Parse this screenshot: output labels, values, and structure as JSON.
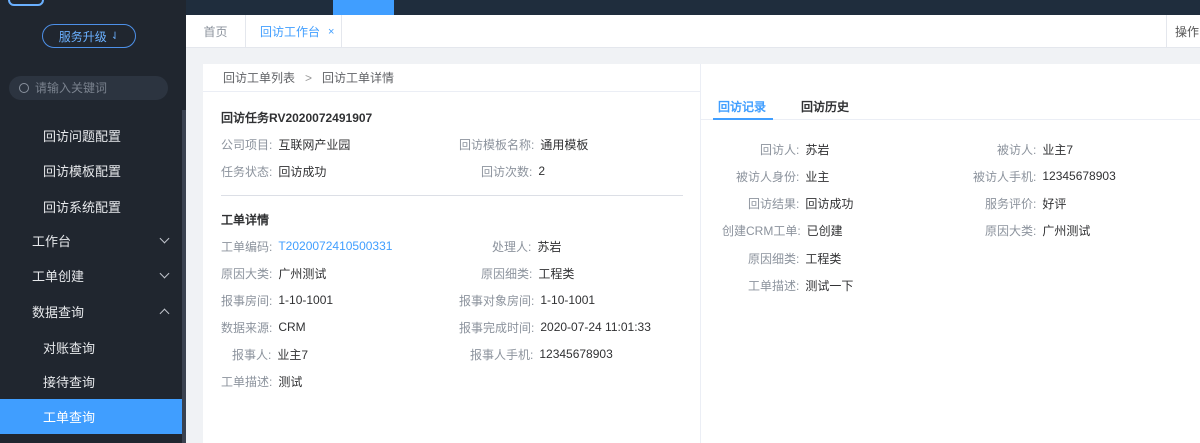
{
  "sidebar": {
    "upgrade_label": "服务升级",
    "search_placeholder": "请输入关键词",
    "menu": [
      {
        "label": "回访问题配置"
      },
      {
        "label": "回访模板配置"
      },
      {
        "label": "回访系统配置"
      },
      {
        "label": "工作台"
      },
      {
        "label": "工单创建"
      },
      {
        "label": "数据查询"
      },
      {
        "label": "对账查询"
      },
      {
        "label": "接待查询"
      },
      {
        "label": "工单查询"
      }
    ]
  },
  "tabs": {
    "home": "首页",
    "active": "回访工作台",
    "close": "×",
    "ops": "操作"
  },
  "breadcrumb": {
    "parent": "回访工单列表",
    "sep": ">",
    "current": "回访工单详情"
  },
  "task": {
    "title": "回访任务RV2020072491907",
    "company_label": "公司项目:",
    "company_value": "互联网产业园",
    "template_label": "回访模板名称:",
    "template_value": "通用模板",
    "status_label": "任务状态:",
    "status_value": "回访成功",
    "count_label": "回访次数:",
    "count_value": "2"
  },
  "ticket": {
    "title": "工单详情",
    "code_label": "工单编码:",
    "code_value": "T2020072410500331",
    "handler_label": "处理人:",
    "handler_value": "苏岩",
    "cause_major_label": "原因大类:",
    "cause_major_value": "广州测试",
    "cause_minor_label": "原因细类:",
    "cause_minor_value": "工程类",
    "room_label": "报事房间:",
    "room_value": "1-10-1001",
    "target_room_label": "报事对象房间:",
    "target_room_value": "1-10-1001",
    "source_label": "数据来源:",
    "source_value": "CRM",
    "done_time_label": "报事完成时间:",
    "done_time_value": "2020-07-24 11:01:33",
    "reporter_label": "报事人:",
    "reporter_value": "业主7",
    "reporter_phone_label": "报事人手机:",
    "reporter_phone_value": "12345678903",
    "desc_label": "工单描述:",
    "desc_value": "测试"
  },
  "record": {
    "tab_record": "回访记录",
    "tab_history": "回访历史",
    "visitor_label": "回访人:",
    "visitor_value": "苏岩",
    "visitee_label": "被访人:",
    "visitee_value": "业主7",
    "identity_label": "被访人身份:",
    "identity_value": "业主",
    "visitee_phone_label": "被访人手机:",
    "visitee_phone_value": "12345678903",
    "result_label": "回访结果:",
    "result_value": "回访成功",
    "rating_label": "服务评价:",
    "rating_value": "好评",
    "crm_label": "创建CRM工单:",
    "crm_value": "已创建",
    "cause_major_label": "原因大类:",
    "cause_major_value": "广州测试",
    "cause_minor_label": "原因细类:",
    "cause_minor_value": "工程类",
    "desc_label": "工单描述:",
    "desc_value": "测试一下"
  },
  "colors": {
    "accent": "#409eff",
    "sidebar_bg": "#20262f"
  }
}
